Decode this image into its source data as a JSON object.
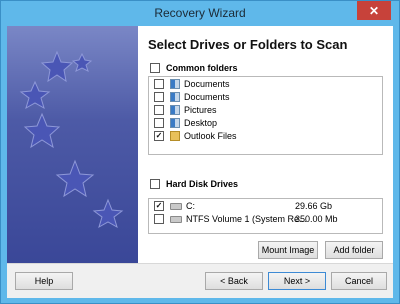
{
  "window": {
    "title": "Recovery Wizard",
    "close_glyph": "✕"
  },
  "page": {
    "heading": "Select Drives or Folders to Scan"
  },
  "common_folders": {
    "label": "Common folders",
    "checked": false,
    "items": [
      {
        "name": "Documents",
        "icon": "document-library-icon",
        "checked": false
      },
      {
        "name": "Documents",
        "icon": "document-library-icon",
        "checked": false
      },
      {
        "name": "Pictures",
        "icon": "picture-library-icon",
        "checked": false
      },
      {
        "name": "Desktop",
        "icon": "desktop-icon",
        "checked": false
      },
      {
        "name": "Outlook Files",
        "icon": "folder-icon",
        "checked": true
      }
    ]
  },
  "hard_disk_drives": {
    "label": "Hard Disk Drives",
    "checked": false,
    "items": [
      {
        "name": "C:",
        "size": "29.66 Gb",
        "icon": "drive-icon",
        "checked": true
      },
      {
        "name": "NTFS Volume 1 (System Re...",
        "size": "350.00 Mb",
        "icon": "drive-icon",
        "checked": false
      }
    ]
  },
  "buttons": {
    "mount_image": "Mount Image",
    "add_folder": "Add folder",
    "help": "Help",
    "back": "< Back",
    "next": "Next >",
    "cancel": "Cancel"
  },
  "colors": {
    "title_bar": "#5fb8ea",
    "banner": "#4d5aa6",
    "close_button": "#c7423a"
  }
}
